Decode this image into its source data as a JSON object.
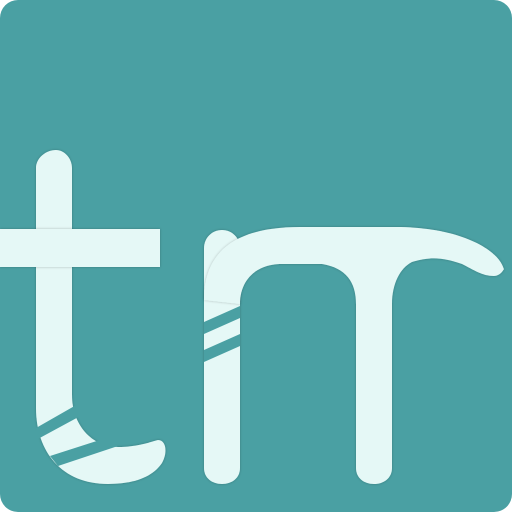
{
  "logo": {
    "text": "tm"
  },
  "colors": {
    "background": "#4aa0a3",
    "letter": "#e5f8f6",
    "stripe": "#4aa0a3"
  }
}
